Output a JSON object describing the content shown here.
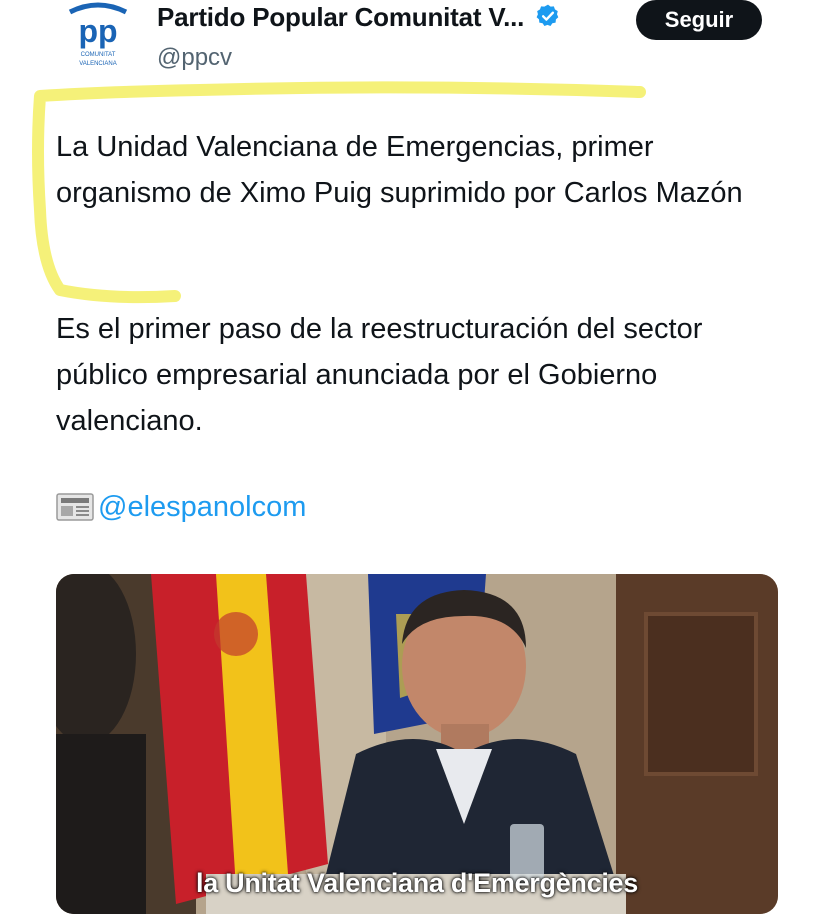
{
  "post": {
    "author_name": "Partido Popular Comunitat V...",
    "handle": "@ppcv",
    "follow_label": "Seguir",
    "avatar_logo": {
      "letters": "pp",
      "line1": "COMUNITAT",
      "line2": "VALENCIANA"
    },
    "paragraph1": "La Unidad Valenciana de Emergencias, primer organismo de Ximo Puig suprimido por Carlos Mazón",
    "paragraph2": "Es el primer paso de la reestructuración del sector público empresarial anunciada por el Gobierno valenciano.",
    "source_mention": "@elespanolcom",
    "media": {
      "caption": "la Unitat Valenciana d'Emergències"
    }
  },
  "colors": {
    "text": "#0f1419",
    "secondary": "#536471",
    "link": "#1d9bf0",
    "brand": "#1a64b5",
    "verified": "#1d9bf0",
    "highlight": "#f4f06a"
  }
}
